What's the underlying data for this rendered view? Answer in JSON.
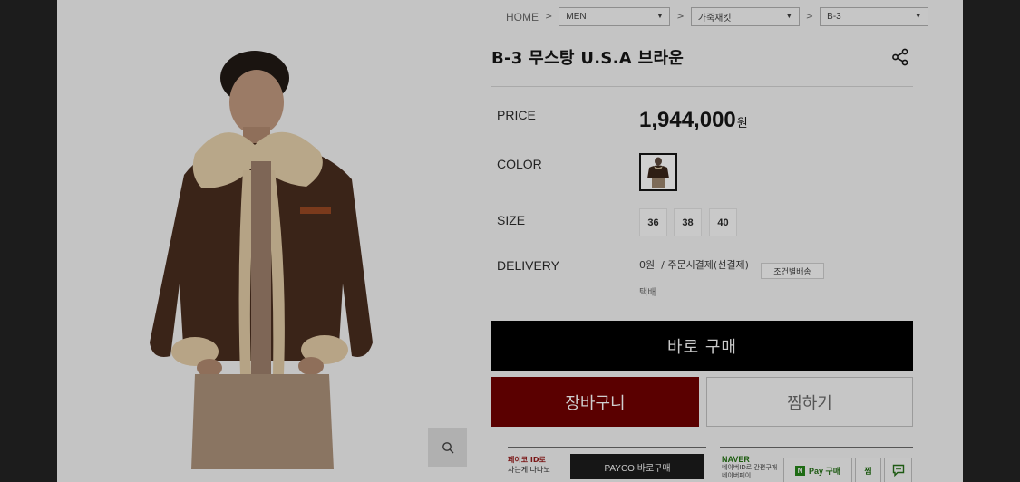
{
  "breadcrumb": {
    "home": "HOME",
    "separator": ">",
    "category_1": "MEN",
    "category_2": "가죽재킷",
    "category_3": "B-3"
  },
  "product": {
    "title": "B-3 무스탕 U.S.A 브라운",
    "price_label": "PRICE",
    "price_value": "1,944,000",
    "price_unit": "원",
    "color_label": "COLOR",
    "size_label": "SIZE",
    "sizes": [
      "36",
      "38",
      "40"
    ],
    "delivery_label": "DELIVERY",
    "delivery_fee": "0원",
    "delivery_payment": "/ 주문시결제(선결제)",
    "delivery_condition_button": "조건별배송",
    "delivery_method": "택배"
  },
  "actions": {
    "buy_now": "바로 구매",
    "cart": "장바구니",
    "wishlist": "찜하기"
  },
  "payco": {
    "promo_line_1": "페이코 ID로",
    "promo_line_2": "사는게 나나노",
    "button": "PAYCO 바로구매"
  },
  "naver": {
    "brand": "NAVER",
    "promo_line_1": "네이버ID로 간편구매",
    "promo_line_2": "네이버페이",
    "pay_button": "Pay 구매",
    "pay_badge": "N",
    "zzim_button": "찜"
  },
  "icons": {
    "share": "share-icon",
    "zoom": "search-icon",
    "talk": "talk-icon",
    "caret": "chevron-down-icon"
  },
  "colors": {
    "overlay_page": "#c4c4c4",
    "frame": "#1c1c1c",
    "cart_button": "#5a0000",
    "buy_button": "#000000",
    "naver_green": "#1e5a13"
  }
}
